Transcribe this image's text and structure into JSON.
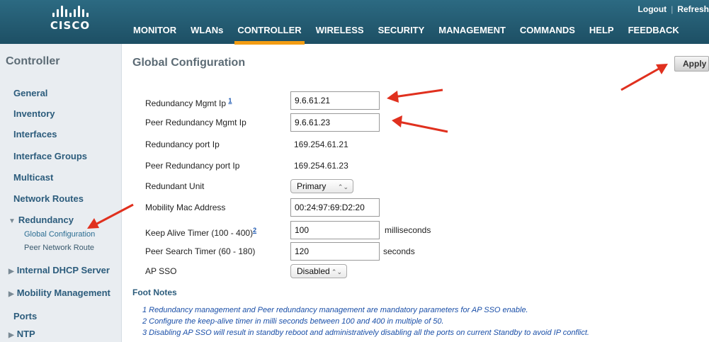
{
  "brand": {
    "logo_text": "CISCO"
  },
  "top_links": {
    "logout": "Logout",
    "refresh": "Refresh"
  },
  "nav": [
    {
      "label": "MONITOR"
    },
    {
      "label": "WLANs"
    },
    {
      "label": "CONTROLLER"
    },
    {
      "label": "WIRELESS"
    },
    {
      "label": "SECURITY"
    },
    {
      "label": "MANAGEMENT"
    },
    {
      "label": "COMMANDS"
    },
    {
      "label": "HELP"
    },
    {
      "label": "FEEDBACK"
    }
  ],
  "active_nav": "CONTROLLER",
  "accent_color": "#f39c12",
  "sidebar": {
    "title": "Controller",
    "items": [
      {
        "label": "General"
      },
      {
        "label": "Inventory"
      },
      {
        "label": "Interfaces"
      },
      {
        "label": "Interface Groups"
      },
      {
        "label": "Multicast"
      },
      {
        "label": "Network Routes"
      },
      {
        "label": "Redundancy"
      },
      {
        "label": "Internal DHCP Server"
      },
      {
        "label": "Mobility Management"
      },
      {
        "label": "Ports"
      },
      {
        "label": "NTP"
      }
    ],
    "sub_items": [
      {
        "label": "Global Configuration"
      },
      {
        "label": "Peer Network Route"
      }
    ]
  },
  "page": {
    "title": "Global Configuration",
    "apply_label": "Apply"
  },
  "form": {
    "redundancy_mgmt_ip_label": "Redundancy Mgmt Ip",
    "redundancy_mgmt_ip_note": "1",
    "redundancy_mgmt_ip_value": "9.6.61.21",
    "peer_redundancy_mgmt_ip_label": "Peer Redundancy Mgmt Ip",
    "peer_redundancy_mgmt_ip_value": "9.6.61.23",
    "redundancy_port_ip_label": "Redundancy port Ip",
    "redundancy_port_ip_value": "169.254.61.21",
    "peer_redundancy_port_ip_label": "Peer Redundancy port Ip",
    "peer_redundancy_port_ip_value": "169.254.61.23",
    "redundant_unit_label": "Redundant Unit",
    "redundant_unit_value": "Primary",
    "mobility_mac_label": "Mobility Mac Address",
    "mobility_mac_value": "00:24:97:69:D2:20",
    "keep_alive_label": "Keep Alive Timer (100 - 400)",
    "keep_alive_note": "2",
    "keep_alive_value": "100",
    "keep_alive_unit": "milliseconds",
    "peer_search_label": "Peer Search Timer (60 - 180)",
    "peer_search_value": "120",
    "peer_search_unit": "seconds",
    "ap_sso_label": "AP SSO",
    "ap_sso_value": "Disabled"
  },
  "footnotes": {
    "title": "Foot Notes",
    "items": [
      "1 Redundancy management and Peer redundancy management are mandatory parameters for AP SSO enable.",
      "2 Configure the keep-alive timer in milli seconds between 100 and 400 in multiple of 50.",
      "3 Disabling AP SSO will result in standby reboot and administratively disabling all the ports on current Standby to avoid IP conflict."
    ]
  },
  "annotation_color": "#e0301e",
  "select_arrows_glyph": "⌃⌄"
}
